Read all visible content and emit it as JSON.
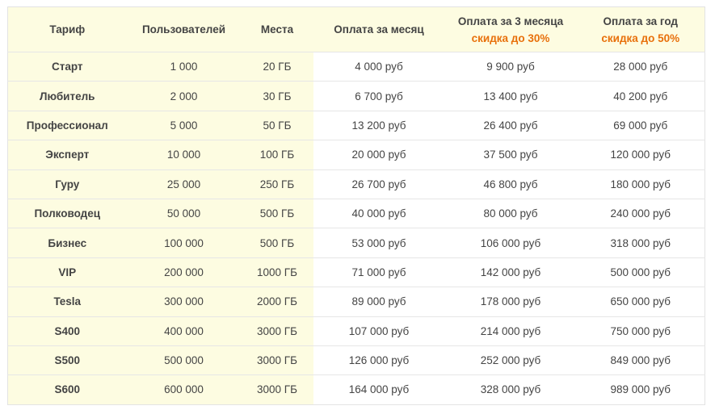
{
  "headers": {
    "tariff": "Тариф",
    "users": "Пользователей",
    "storage": "Места",
    "monthly": "Оплата за месяц",
    "quarterly": "Оплата за 3 месяца",
    "quarterly_discount": "скидка до 30%",
    "yearly": "Оплата за год",
    "yearly_discount": "скидка до 50%"
  },
  "colors": {
    "highlight_bg": "#fdfce1",
    "discount_text": "#e8700b",
    "border": "#e6e6e6"
  },
  "rows": [
    {
      "tariff": "Старт",
      "users": "1 000",
      "storage": "20 ГБ",
      "monthly": "4 000 руб",
      "quarterly": "9 900 руб",
      "yearly": "28 000 руб"
    },
    {
      "tariff": "Любитель",
      "users": "2 000",
      "storage": "30 ГБ",
      "monthly": "6 700 руб",
      "quarterly": "13 400 руб",
      "yearly": "40 200 руб"
    },
    {
      "tariff": "Профессионал",
      "users": "5 000",
      "storage": "50 ГБ",
      "monthly": "13 200 руб",
      "quarterly": "26 400 руб",
      "yearly": "69 000 руб"
    },
    {
      "tariff": "Эксперт",
      "users": "10 000",
      "storage": "100 ГБ",
      "monthly": "20 000 руб",
      "quarterly": "37 500 руб",
      "yearly": "120 000 руб"
    },
    {
      "tariff": "Гуру",
      "users": "25 000",
      "storage": "250 ГБ",
      "monthly": "26 700 руб",
      "quarterly": "46 800 руб",
      "yearly": "180 000 руб"
    },
    {
      "tariff": "Полководец",
      "users": "50 000",
      "storage": "500 ГБ",
      "monthly": "40 000 руб",
      "quarterly": "80 000 руб",
      "yearly": "240 000 руб"
    },
    {
      "tariff": "Бизнес",
      "users": "100 000",
      "storage": "500 ГБ",
      "monthly": "53 000 руб",
      "quarterly": "106 000 руб",
      "yearly": "318 000 руб"
    },
    {
      "tariff": "VIP",
      "users": "200 000",
      "storage": "1000 ГБ",
      "monthly": "71 000 руб",
      "quarterly": "142 000 руб",
      "yearly": "500 000 руб"
    },
    {
      "tariff": "Tesla",
      "users": "300 000",
      "storage": "2000 ГБ",
      "monthly": "89 000 руб",
      "quarterly": "178 000 руб",
      "yearly": "650 000 руб"
    },
    {
      "tariff": "S400",
      "users": "400 000",
      "storage": "3000 ГБ",
      "monthly": "107 000 руб",
      "quarterly": "214 000 руб",
      "yearly": "750 000 руб"
    },
    {
      "tariff": "S500",
      "users": "500 000",
      "storage": "3000 ГБ",
      "monthly": "126 000 руб",
      "quarterly": "252 000 руб",
      "yearly": "849 000 руб"
    },
    {
      "tariff": "S600",
      "users": "600 000",
      "storage": "3000 ГБ",
      "monthly": "164 000 руб",
      "quarterly": "328 000 руб",
      "yearly": "989 000 руб"
    }
  ]
}
